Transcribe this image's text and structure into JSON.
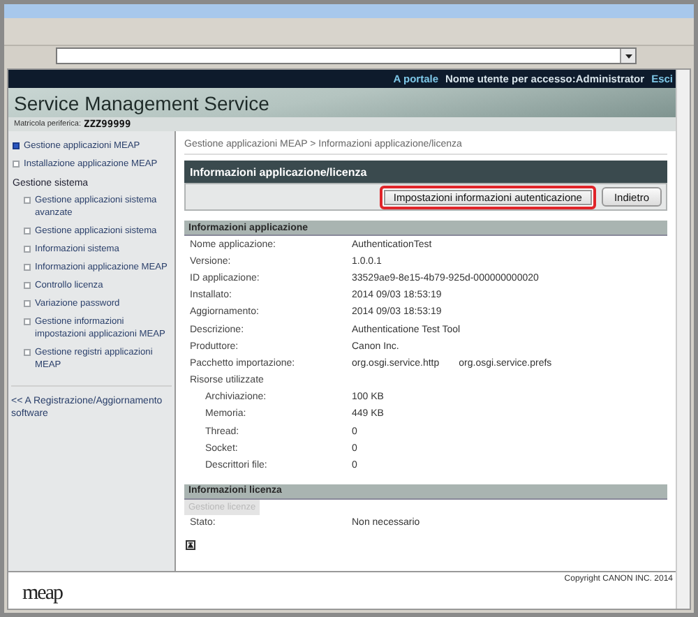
{
  "header": {
    "portal_link": "A portale",
    "user": "Nome utente per accesso:Administrator",
    "logout": "Esci"
  },
  "title": "Service Management Service",
  "serial": {
    "label": "Matricola periferica:",
    "value": "ZZZ99999"
  },
  "sidebar": {
    "items": [
      {
        "label": "Gestione applicazioni MEAP",
        "selected": true
      },
      {
        "label": "Installazione applicazione MEAP",
        "selected": false
      }
    ],
    "section": "Gestione sistema",
    "sub_items": [
      {
        "label": "Gestione applicazioni sistema avanzate",
        "selected": false
      },
      {
        "label": "Gestione applicazioni sistema",
        "selected": false
      },
      {
        "label": "Informazioni sistema",
        "selected": false
      },
      {
        "label": "Informazioni applicazione MEAP",
        "selected": false
      },
      {
        "label": "Controllo licenza",
        "selected": false
      },
      {
        "label": "Variazione password",
        "selected": false
      },
      {
        "label": "Gestione informazioni impostazioni applicazioni MEAP",
        "selected": false
      },
      {
        "label": "Gestione registri applicazioni MEAP",
        "selected": false
      }
    ],
    "back_link": "<< A Registrazione/Aggiornamento software"
  },
  "breadcrumb": "Gestione applicazioni MEAP > Informazioni applicazione/licenza",
  "panel": {
    "title": "Informazioni applicazione/licenza",
    "buttons": [
      {
        "label": "Impostazioni informazioni autenticazione",
        "highlighted": true
      },
      {
        "label": "Indietro",
        "highlighted": false
      }
    ]
  },
  "app_info": {
    "title": "Informazioni applicazione",
    "rows": [
      {
        "label": "Nome applicazione:",
        "values": [
          "AuthenticationTest"
        ]
      },
      {
        "label": "Versione:",
        "values": [
          "1.0.0.1"
        ]
      },
      {
        "label": "ID applicazione:",
        "values": [
          "33529ae9-8e15-4b79-925d-000000000020"
        ]
      },
      {
        "label": "Installato:",
        "values": [
          "2014 09/03 18:53:19"
        ]
      },
      {
        "label": "Aggiornamento:",
        "values": [
          "2014 09/03 18:53:19"
        ]
      },
      {
        "label": "Descrizione:",
        "values": [
          "Authenticatione Test Tool"
        ]
      },
      {
        "label": "Produttore:",
        "values": [
          "Canon Inc."
        ]
      },
      {
        "label": "Pacchetto importazione:",
        "values": [
          "org.osgi.service.http",
          "org.osgi.service.prefs"
        ]
      }
    ],
    "resources": {
      "label": "Risorse utilizzate",
      "rows": [
        {
          "label": "Archiviazione:",
          "value": "100 KB"
        },
        {
          "label": "Memoria:",
          "value": "449 KB"
        },
        {
          "label": "Thread:",
          "value": "0"
        },
        {
          "label": "Socket:",
          "value": "0"
        },
        {
          "label": "Descrittori file:",
          "value": "0"
        }
      ]
    }
  },
  "license": {
    "title": "Informazioni licenza",
    "button": {
      "label": "Gestione licenze",
      "disabled": true
    },
    "rows": [
      {
        "label": "Stato:",
        "value": "Non necessario"
      }
    ]
  },
  "footer": {
    "logo": "meap",
    "copyright": "Copyright CANON INC. 2014"
  }
}
